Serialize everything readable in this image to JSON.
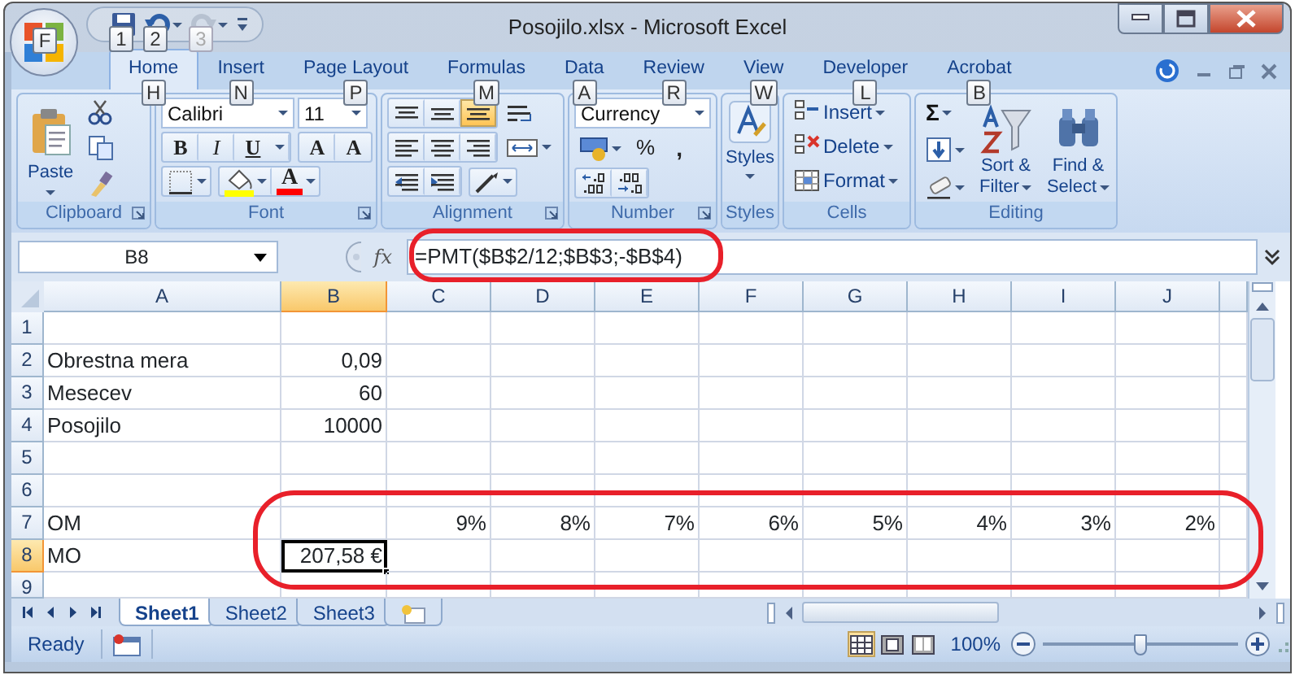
{
  "window": {
    "title": "Posojilo.xlsx - Microsoft Excel"
  },
  "office_button": {
    "keytip": "F"
  },
  "quick_access": [
    {
      "keytip": "1",
      "disabled": false
    },
    {
      "keytip": "2",
      "disabled": false
    },
    {
      "keytip": "3",
      "disabled": true
    }
  ],
  "tabs": [
    {
      "label": "Home",
      "keytip": "H",
      "selected": true
    },
    {
      "label": "Insert",
      "keytip": "N",
      "selected": false
    },
    {
      "label": "Page Layout",
      "keytip": "P",
      "selected": false
    },
    {
      "label": "Formulas",
      "keytip": "M",
      "selected": false
    },
    {
      "label": "Data",
      "keytip": "A",
      "selected": false
    },
    {
      "label": "Review",
      "keytip": "R",
      "selected": false
    },
    {
      "label": "View",
      "keytip": "W",
      "selected": false
    },
    {
      "label": "Developer",
      "keytip": "L",
      "selected": false
    },
    {
      "label": "Acrobat",
      "keytip": "B",
      "selected": false
    }
  ],
  "ribbon": {
    "clipboard": {
      "title": "Clipboard",
      "paste": "Paste"
    },
    "font": {
      "title": "Font",
      "font_name": "Calibri",
      "font_size": "11",
      "bold": "B",
      "italic": "I",
      "underline": "U",
      "grow": "A",
      "shrink": "A",
      "color_letter": "A"
    },
    "alignment": {
      "title": "Alignment",
      "vertical": [
        {
          "selected": false
        },
        {
          "selected": false
        },
        {
          "selected": true
        }
      ]
    },
    "number": {
      "title": "Number",
      "format": "Currency",
      "percent": "%",
      "comma": ","
    },
    "styles": {
      "title": "Styles",
      "label": "Styles"
    },
    "cells": {
      "title": "Cells",
      "items": [
        "Insert",
        "Delete",
        "Format"
      ]
    },
    "editing": {
      "title": "Editing",
      "sum": "Σ",
      "sort": [
        "Sort &",
        "Filter"
      ],
      "find": [
        "Find &",
        "Select"
      ]
    }
  },
  "formula_bar": {
    "name_box": "B8",
    "fx": "fx",
    "formula": "=PMT($B$2/12;$B$3;-$B$4)",
    "circled": true
  },
  "sheet": {
    "columns": [
      {
        "label": "A",
        "selected": false
      },
      {
        "label": "B",
        "selected": true
      },
      {
        "label": "C",
        "selected": false
      },
      {
        "label": "D",
        "selected": false
      },
      {
        "label": "E",
        "selected": false
      },
      {
        "label": "F",
        "selected": false
      },
      {
        "label": "G",
        "selected": false
      },
      {
        "label": "H",
        "selected": false
      },
      {
        "label": "I",
        "selected": false
      },
      {
        "label": "J",
        "selected": false
      }
    ],
    "rows": [
      {
        "header": "1",
        "selected": false
      },
      {
        "header": "2",
        "selected": false,
        "cells": [
          "Obrestna mera",
          "0,09"
        ]
      },
      {
        "header": "3",
        "selected": false,
        "cells": [
          "Mesecev",
          "60"
        ]
      },
      {
        "header": "4",
        "selected": false,
        "cells": [
          "Posojilo",
          "10000"
        ]
      },
      {
        "header": "5",
        "selected": false
      },
      {
        "header": "6",
        "selected": false
      },
      {
        "header": "7",
        "selected": false,
        "circled": true,
        "cells": [
          "OM",
          null,
          "9%",
          "8%",
          "7%",
          "6%",
          "5%",
          "4%",
          "3%",
          "2%"
        ]
      },
      {
        "header": "8",
        "selected": true,
        "circled": true,
        "cells": [
          "MO",
          "207,58 €"
        ]
      },
      {
        "header": "9",
        "selected": false
      }
    ]
  },
  "sheet_tabs": [
    {
      "label": "Sheet1",
      "selected": true
    },
    {
      "label": "Sheet2",
      "selected": false
    },
    {
      "label": "Sheet3",
      "selected": false
    }
  ],
  "status_bar": {
    "status": "Ready",
    "views": [
      {
        "selected": true
      },
      {
        "selected": false
      },
      {
        "selected": false
      }
    ],
    "zoom": "100%",
    "zoom_slider": {
      "level": 0.5
    }
  }
}
